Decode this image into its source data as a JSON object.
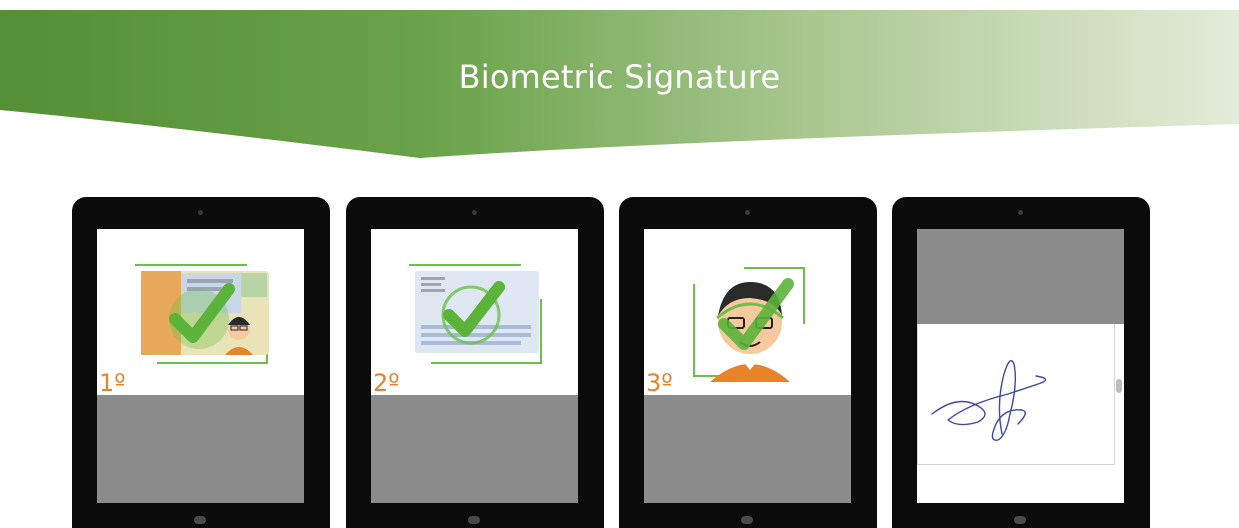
{
  "banner": {
    "title": "Biometric Signature",
    "colors": {
      "dark": "#5e9a3c",
      "light": "#d9e6cc"
    }
  },
  "steps": [
    {
      "label": "1º",
      "illustration": "id-card-check-icon"
    },
    {
      "label": "2º",
      "illustration": "document-back-check-icon"
    },
    {
      "label": "3º",
      "illustration": "face-check-icon"
    },
    {
      "label": "",
      "illustration": "handwritten-signature"
    }
  ],
  "colors": {
    "step_number": "#e8832a",
    "check": "#6cc04a",
    "tablet_frame": "#0b0b0b",
    "screen_grey": "#8c8c8c",
    "signature_ink": "#3c47a8"
  }
}
